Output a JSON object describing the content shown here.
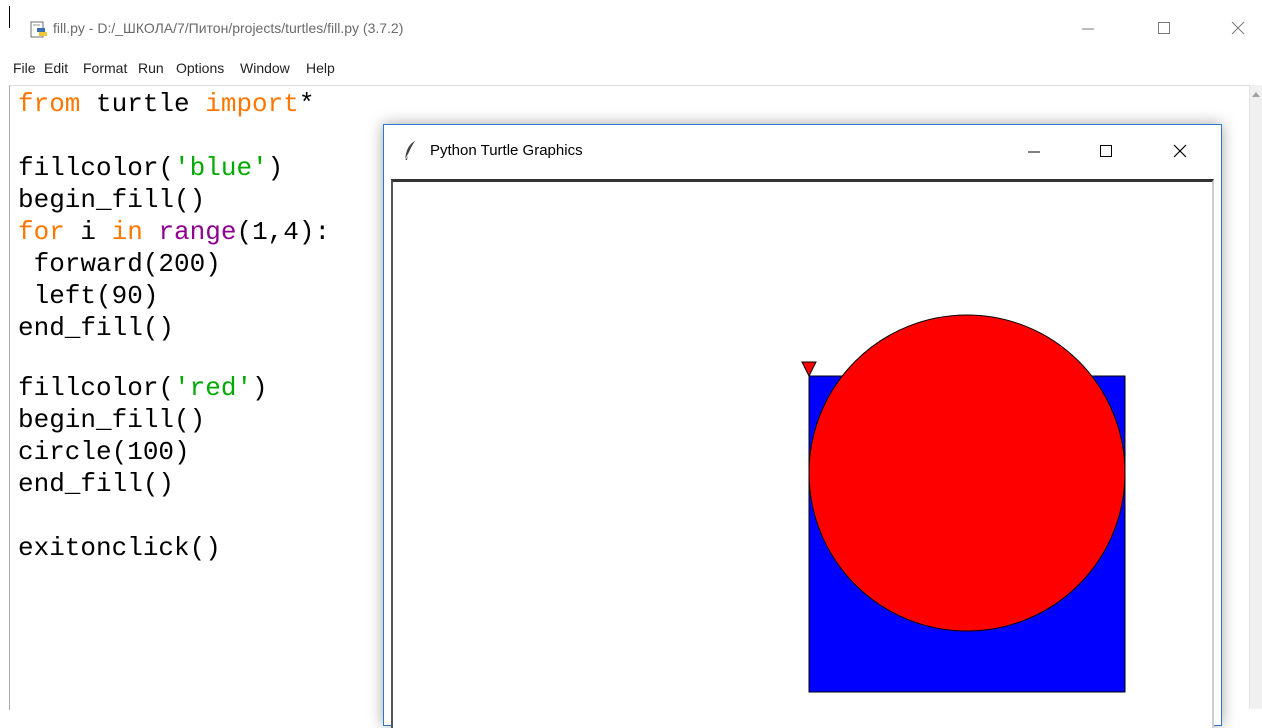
{
  "idle": {
    "title": "fill.py - D:/_ШКОЛА/7/Питон/projects/turtles/fill.py (3.7.2)",
    "menu": [
      "File",
      "Edit",
      "Format",
      "Run",
      "Options",
      "Window",
      "Help"
    ],
    "code": {
      "l1_kw_from": "from",
      "l1_mid": " turtle ",
      "l1_kw_import": "import",
      "l1_end": "*",
      "l3_a": "fillcolor(",
      "l3_str": "'blue'",
      "l3_b": ")",
      "l4": "begin_fill()",
      "l5_kw_for": "for",
      "l5_mid1": " i ",
      "l5_kw_in": "in",
      "l5_mid2": " ",
      "l5_bi_range": "range",
      "l5_end": "(1,4):",
      "l6": " forward(200)",
      "l7": " left(90)",
      "l8": "end_fill()",
      "l10_a": "fillcolor(",
      "l10_str": "'red'",
      "l10_b": ")",
      "l11": "begin_fill()",
      "l12": "circle(100)",
      "l13": "end_fill()",
      "l15": "exitonclick()"
    }
  },
  "turtle_window": {
    "title": "Python Turtle Graphics",
    "drawing": {
      "square": {
        "fillcolor": "blue",
        "side": 200,
        "repeats": 3,
        "turn": 90
      },
      "circle": {
        "fillcolor": "red",
        "radius": 100
      },
      "outline_color": "#000000"
    }
  },
  "colors": {
    "keyword": "#ff7700",
    "string": "#00aa00",
    "builtin": "#900090",
    "blue_fill": "#0000ff",
    "red_fill": "#ff0000",
    "turtle_border": "#2b79c8"
  },
  "icons": {
    "idle_app": "python-file-icon",
    "turtle_app": "feather-icon",
    "minimize": "minimize-icon",
    "maximize": "maximize-icon",
    "close": "close-icon"
  }
}
